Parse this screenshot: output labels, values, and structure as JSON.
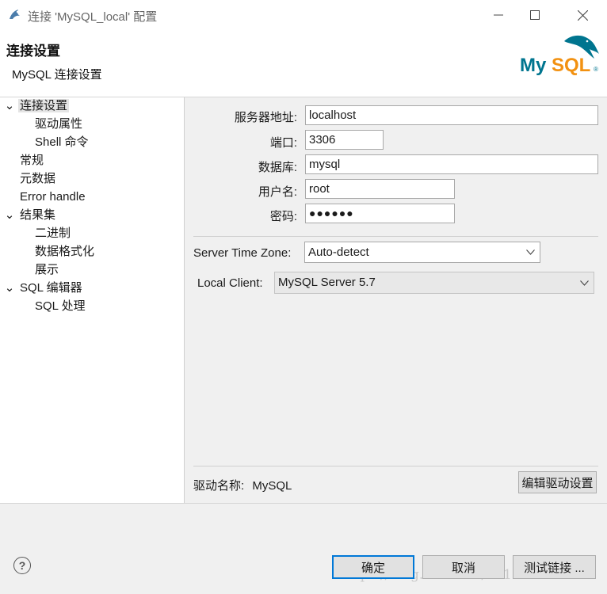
{
  "window": {
    "title": "连接 'MySQL_local' 配置",
    "icon": "dbeaver-beaver-icon"
  },
  "header": {
    "title": "连接设置",
    "description": "MySQL 连接设置",
    "logo": {
      "text_my": "My",
      "text_sql": "SQL",
      "reg": "®",
      "color_my": "#00758f",
      "color_sql": "#f29111"
    }
  },
  "tree": {
    "items": [
      {
        "label": "连接设置",
        "arrow": "⌄",
        "selected": true
      },
      {
        "label": "驱动属性"
      },
      {
        "label": "Shell 命令"
      },
      {
        "label": "常规"
      },
      {
        "label": "元数据"
      },
      {
        "label": "Error handle"
      },
      {
        "label": "结果集",
        "arrow": "⌄"
      },
      {
        "label": "二进制"
      },
      {
        "label": "数据格式化"
      },
      {
        "label": "展示"
      },
      {
        "label": "SQL 编辑器",
        "arrow": "⌄"
      },
      {
        "label": "SQL 处理"
      }
    ]
  },
  "form": {
    "host_label": "服务器地址:",
    "host_value": "localhost",
    "port_label": "端口:",
    "port_value": "3306",
    "database_label": "数据库:",
    "database_value": "mysql",
    "user_label": "用户名:",
    "user_value": "root",
    "password_label": "密码:",
    "password_value": "●●●●●●",
    "timezone_label": "Server Time Zone:",
    "timezone_value": "Auto-detect",
    "client_label": "Local Client:",
    "client_value": "MySQL Server 5.7",
    "driver_label": "驱动名称:",
    "driver_value": "MySQL",
    "edit_driver_button": "编辑驱动设置"
  },
  "footer": {
    "ok_button": "确定",
    "cancel_button": "取消",
    "test_button": "测试链接 ...",
    "watermark": "https://blog.csdn.net/u011435933"
  },
  "colors": {
    "accent": "#0078d7",
    "tree_selected": "#e4e4e4"
  }
}
